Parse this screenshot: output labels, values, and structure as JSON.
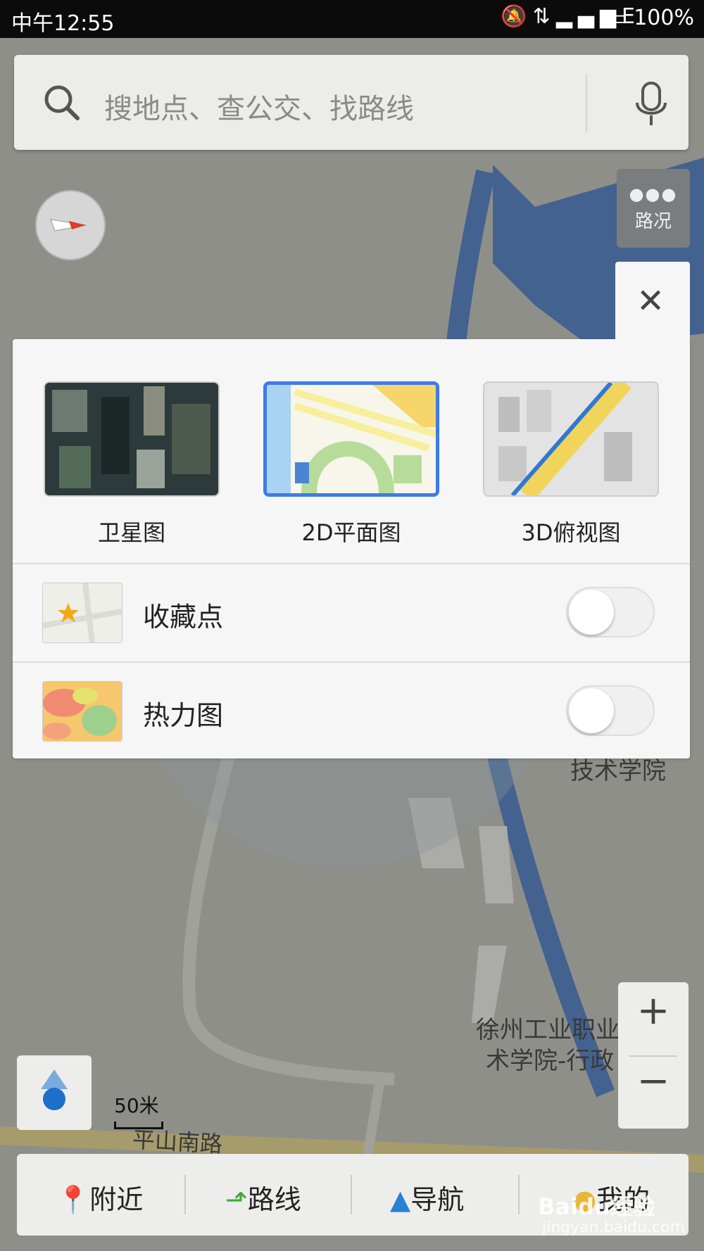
{
  "status": {
    "time": "中午12:55",
    "network": "E",
    "battery": "100%",
    "icons": [
      "mute-icon",
      "data-icon",
      "signal-icon"
    ]
  },
  "search": {
    "placeholder": "搜地点、查公交、找路线"
  },
  "traffic": {
    "label": "路况"
  },
  "map_labels": {
    "tech_college": "技术学院",
    "xuzhou_1": "徐州工业职业",
    "xuzhou_2": "术学院-行政",
    "road": "平山南路"
  },
  "layer_panel": {
    "modes": [
      {
        "label": "卫星图",
        "selected": false
      },
      {
        "label": "2D平面图",
        "selected": true
      },
      {
        "label": "3D俯视图",
        "selected": false
      }
    ],
    "toggles": [
      {
        "label": "收藏点",
        "on": false
      },
      {
        "label": "热力图",
        "on": false
      }
    ]
  },
  "scale": {
    "label": "50米"
  },
  "bottom_nav": [
    {
      "label": "附近",
      "icon": "pin-icon"
    },
    {
      "label": "路线",
      "icon": "route-icon"
    },
    {
      "label": "导航",
      "icon": "navigate-icon"
    },
    {
      "label": "我的",
      "icon": "user-icon"
    }
  ],
  "watermark": {
    "brand": "Baidu经验",
    "url": "jingyan.baidu.com"
  },
  "colors": {
    "accent": "#3d7be8",
    "map_water": "#4a6fa8",
    "status_bar": "#0b0b0b"
  }
}
